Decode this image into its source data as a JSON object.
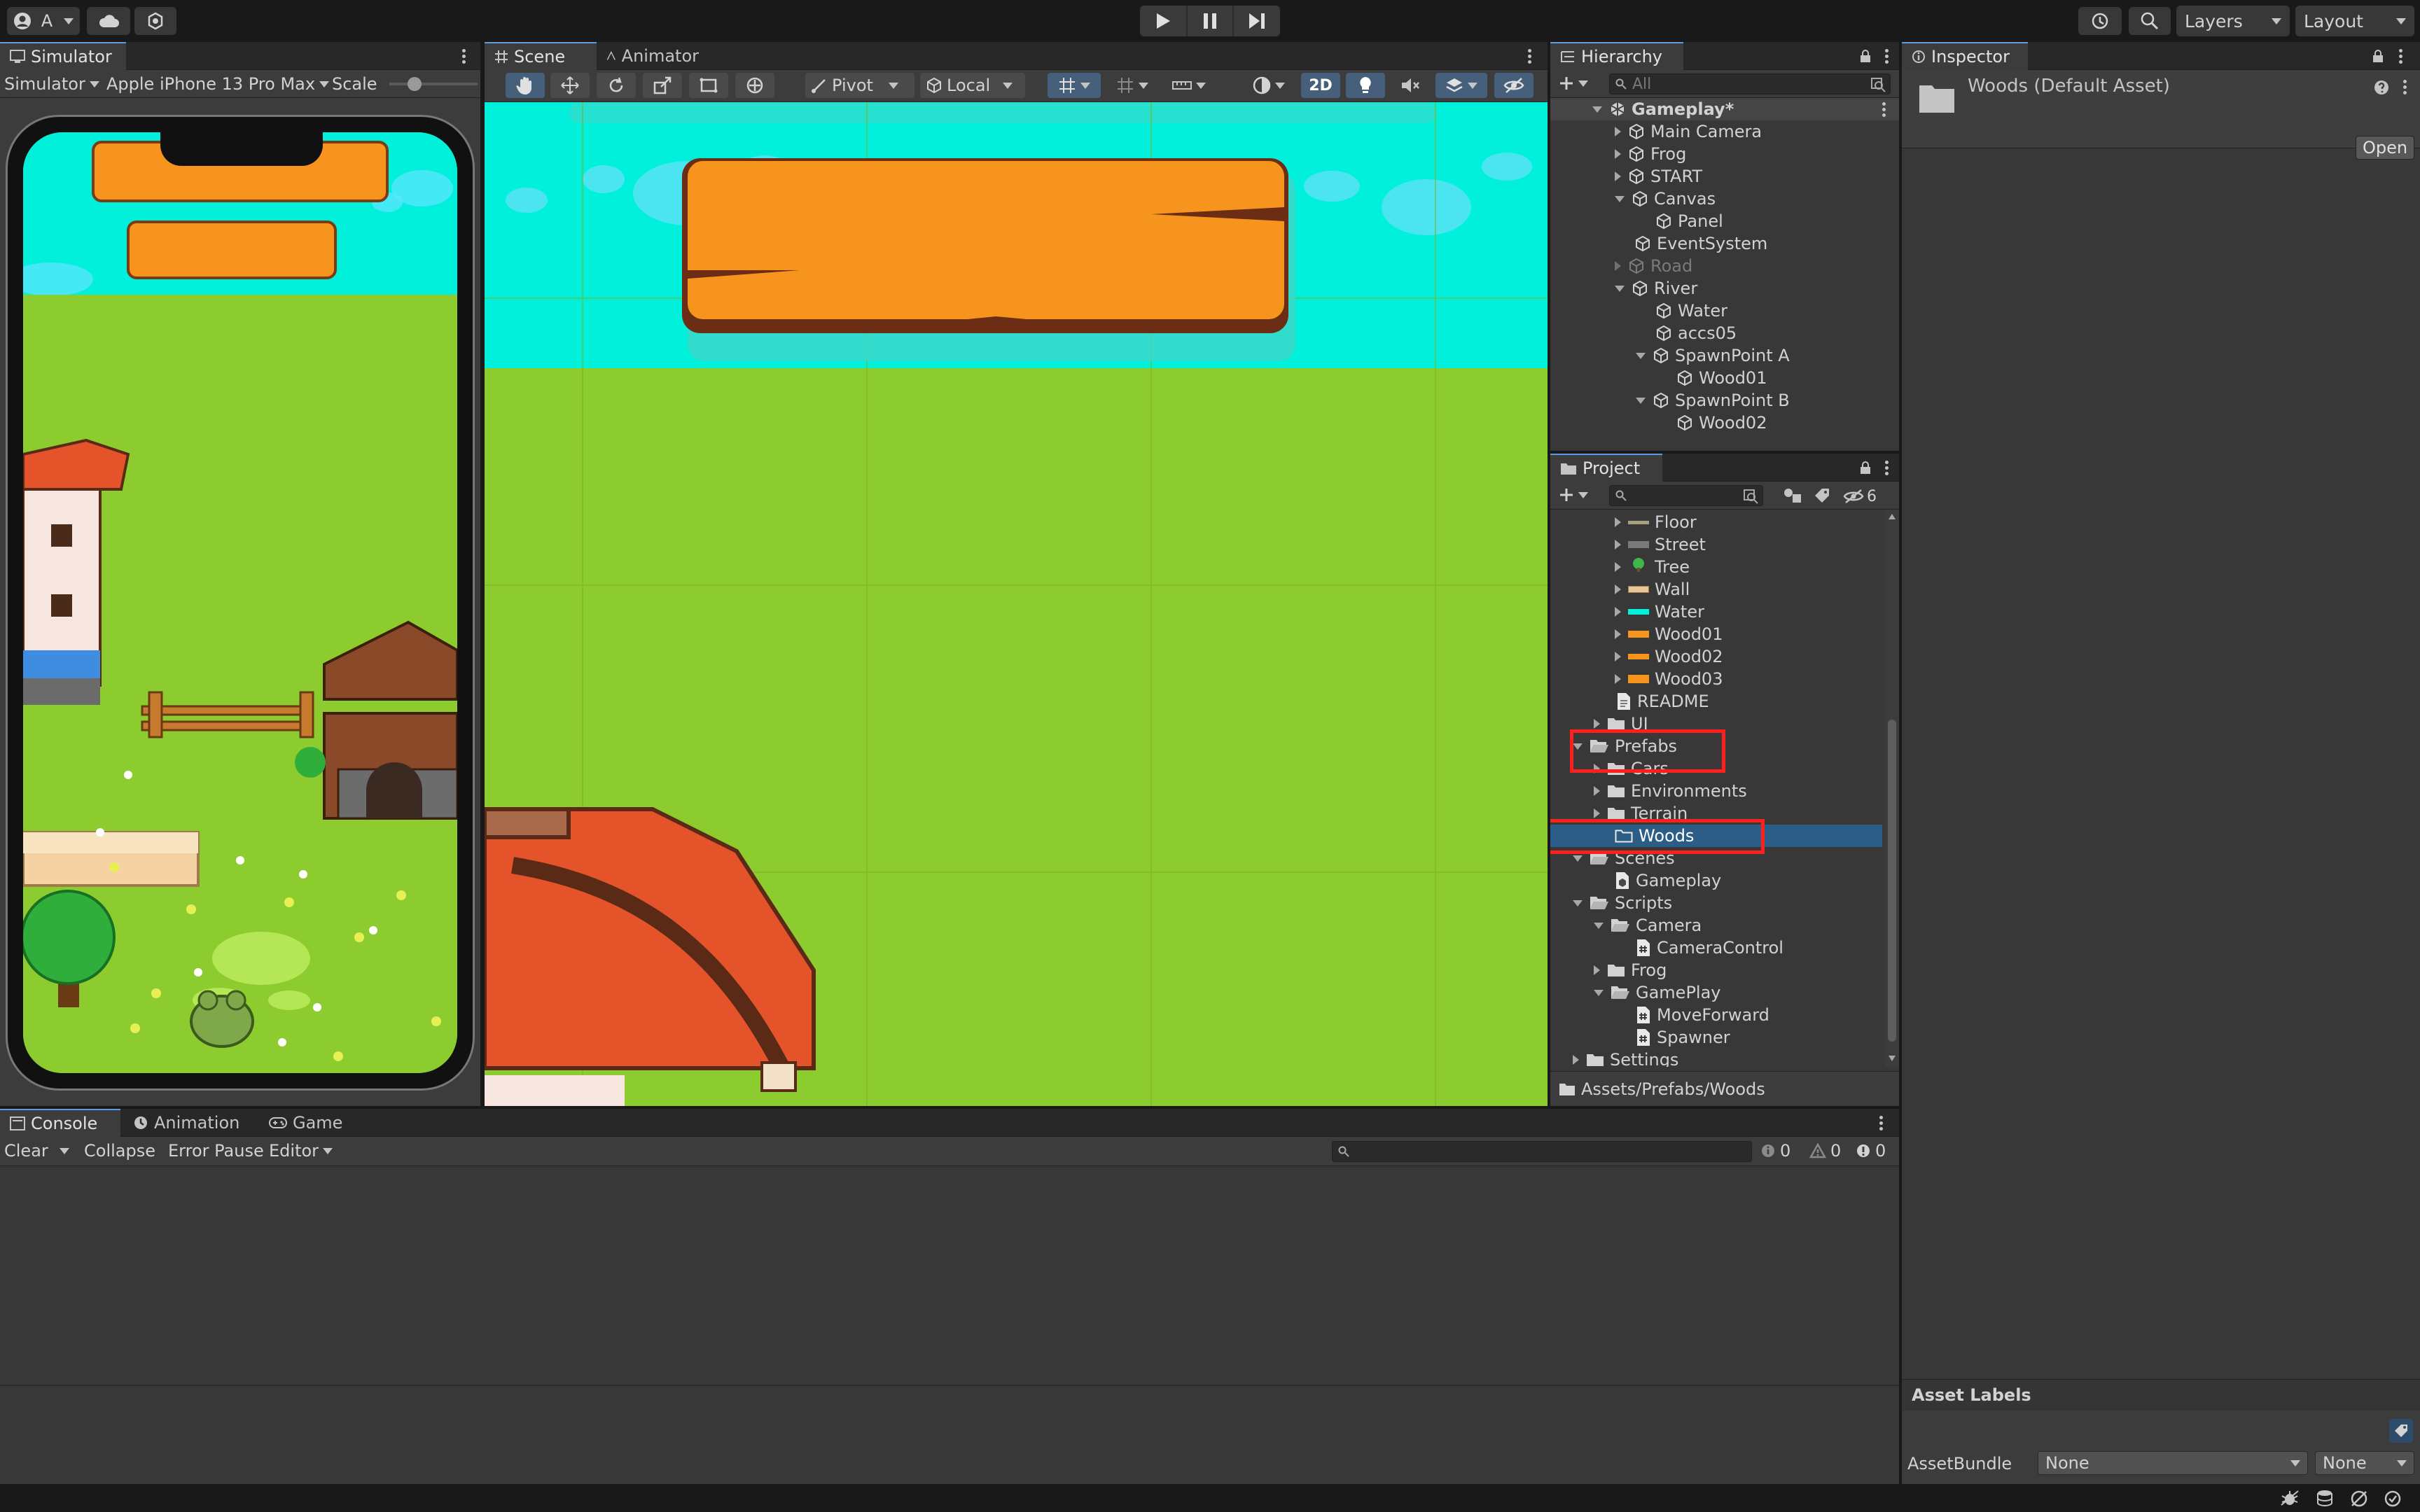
{
  "toolbar": {
    "account_label": "A",
    "layers_label": "Layers",
    "layout_label": "Layout"
  },
  "simulator": {
    "tab_label": "Simulator",
    "mode_label": "Simulator",
    "device_label": "Apple iPhone 13 Pro Max",
    "scale_label": "Scale"
  },
  "scene": {
    "tabs": [
      {
        "label": "Scene"
      },
      {
        "label": "Animator"
      }
    ],
    "pivot_label": "Pivot",
    "local_label": "Local",
    "mode_2d_label": "2D"
  },
  "hierarchy": {
    "tab_label": "Hierarchy",
    "search_placeholder": "All",
    "items": [
      {
        "label": "Gameplay*"
      },
      {
        "label": "Main Camera"
      },
      {
        "label": "Frog"
      },
      {
        "label": "START"
      },
      {
        "label": "Canvas"
      },
      {
        "label": "Panel"
      },
      {
        "label": "EventSystem"
      },
      {
        "label": "Road"
      },
      {
        "label": "River"
      },
      {
        "label": "Water"
      },
      {
        "label": "accs05"
      },
      {
        "label": "SpawnPoint A"
      },
      {
        "label": "Wood01"
      },
      {
        "label": "SpawnPoint B"
      },
      {
        "label": "Wood02"
      }
    ]
  },
  "project": {
    "tab_label": "Project",
    "hidden_count": "6",
    "items": [
      {
        "label": "Floor"
      },
      {
        "label": "Street"
      },
      {
        "label": "Tree"
      },
      {
        "label": "Wall"
      },
      {
        "label": "Water"
      },
      {
        "label": "Wood01"
      },
      {
        "label": "Wood02"
      },
      {
        "label": "Wood03"
      },
      {
        "label": "README"
      },
      {
        "label": "UI"
      },
      {
        "label": "Prefabs"
      },
      {
        "label": "Cars"
      },
      {
        "label": "Environments"
      },
      {
        "label": "Terrain"
      },
      {
        "label": "Woods"
      },
      {
        "label": "Scenes"
      },
      {
        "label": "Gameplay"
      },
      {
        "label": "Scripts"
      },
      {
        "label": "Camera"
      },
      {
        "label": "CameraControl"
      },
      {
        "label": "Frog"
      },
      {
        "label": "GamePlay"
      },
      {
        "label": "MoveForward"
      },
      {
        "label": "Spawner"
      },
      {
        "label": "Settings"
      }
    ],
    "path": "Assets/Prefabs/Woods"
  },
  "inspector": {
    "tab_label": "Inspector",
    "asset_title": "Woods (Default Asset)",
    "open_label": "Open",
    "asset_labels_title": "Asset Labels",
    "assetbundle_label": "AssetBundle",
    "assetbundle_value": "None",
    "variant_value": "None"
  },
  "console": {
    "tabs": [
      {
        "label": "Console"
      },
      {
        "label": "Animation"
      },
      {
        "label": "Game"
      }
    ],
    "clear_label": "Clear",
    "collapse_label": "Collapse",
    "error_pause_label": "Error Pause",
    "editor_label": "Editor",
    "log_count": "0",
    "warning_count": "0",
    "error_count": "0"
  },
  "colors": {
    "selection": "#2c5d87",
    "highlight_box": "#ff1f1f",
    "sky": "#00f0dc",
    "grass": "#8ccc2e",
    "wood_plank": "#f7941d"
  }
}
